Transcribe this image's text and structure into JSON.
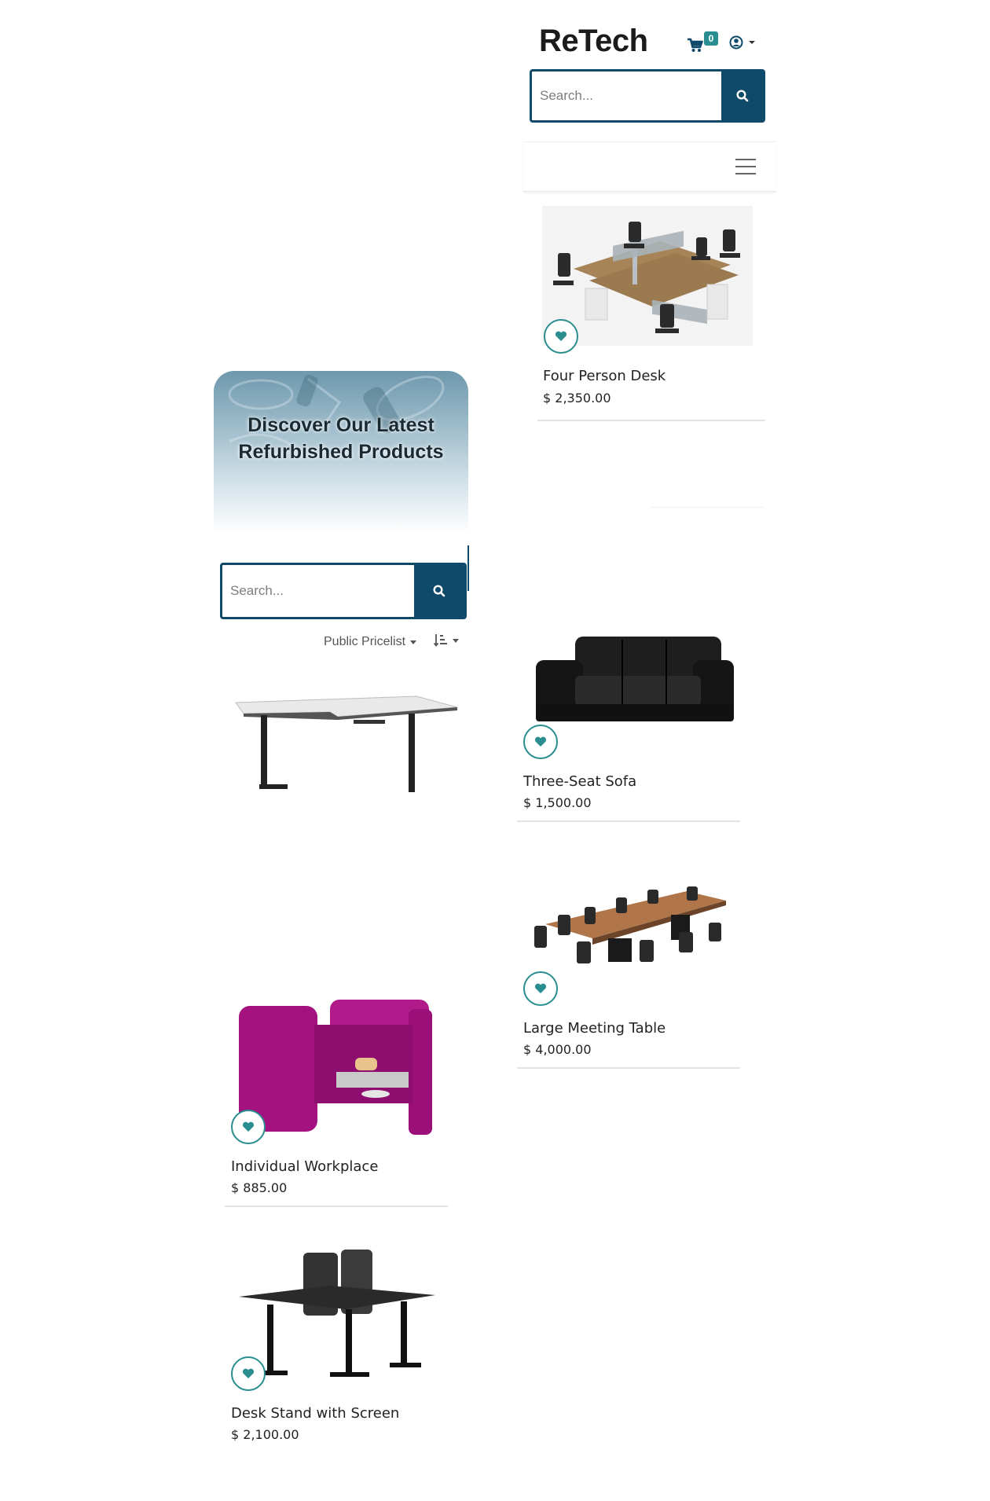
{
  "header": {
    "brand": "ReTech",
    "cart_count": "0",
    "search_placeholder": "Search..."
  },
  "hero": {
    "title_line1": "Discover Our Latest",
    "title_line2": "Refurbished Products"
  },
  "filters": {
    "search_placeholder": "Search...",
    "pricelist_label": "Public Pricelist"
  },
  "products": [
    {
      "name": "Four Person Desk",
      "price": "$ 2,350.00"
    },
    {
      "name": "Three-Seat Sofa",
      "price": "$ 1,500.00"
    },
    {
      "name": "Large Meeting Table",
      "price": "$ 4,000.00"
    },
    {
      "name": "Individual Workplace",
      "price": "$ 885.00"
    },
    {
      "name": "Desk Stand with Screen",
      "price": "$ 2,100.00"
    }
  ],
  "colors": {
    "primary": "#0f4a6a",
    "accent": "#2a8d8f"
  },
  "icons": [
    "cart-icon",
    "user-icon",
    "search-icon",
    "menu-icon",
    "heart-icon",
    "sort-icon"
  ]
}
